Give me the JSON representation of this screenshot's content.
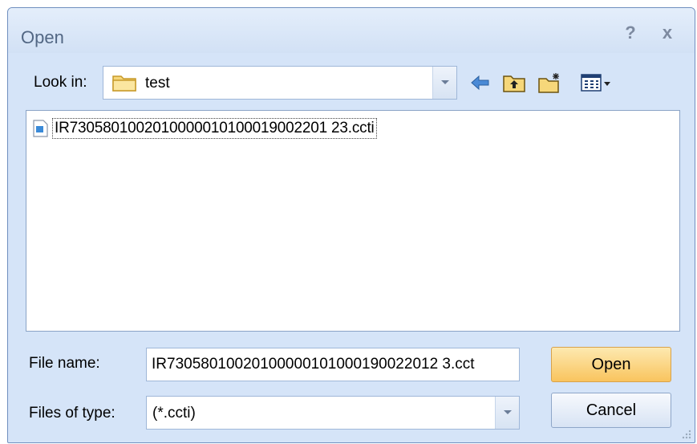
{
  "window": {
    "title": "Open",
    "help_glyph": "?",
    "close_glyph": "x"
  },
  "lookin": {
    "label": "Look in:",
    "value": "test",
    "icon": "folder-icon"
  },
  "toolbar": {
    "icons": [
      "back-arrow-icon",
      "up-folder-icon",
      "new-folder-icon",
      "views-menu-icon"
    ]
  },
  "file_list": {
    "items": [
      {
        "name": "IR7305801002010000010100019002201 23.ccti",
        "icon": "file-icon"
      }
    ]
  },
  "filename": {
    "label": "File name:",
    "value": "IR73058010020100000101000190022012 3.cct"
  },
  "filetype": {
    "label": "Files of type:",
    "value": "(*.ccti)"
  },
  "buttons": {
    "open": "Open",
    "cancel": "Cancel"
  },
  "colors": {
    "dialog_bg": "#d5e4f8",
    "open_button": "#f9c45e",
    "title_text": "#526784"
  }
}
